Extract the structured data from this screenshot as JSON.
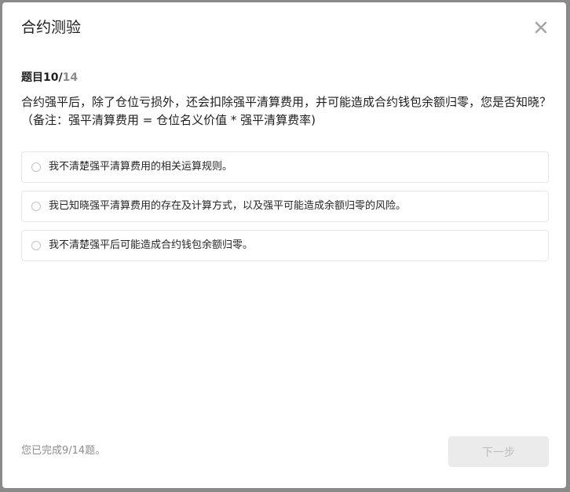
{
  "dialog": {
    "title": "合约测验",
    "close_icon": "close-icon"
  },
  "progress": {
    "label": "题目",
    "current": "10",
    "separator": "/",
    "total": "14"
  },
  "question": {
    "text": "合约强平后，除了仓位亏损外，还会扣除强平清算费用，并可能造成合约钱包余额归零，您是否知晓？（备注：强平清算费用 = 仓位名义价值 * 强平清算费率)"
  },
  "options": [
    {
      "label": "我不清楚强平清算费用的相关运算规则。",
      "selected": false
    },
    {
      "label": "我已知晓强平清算费用的存在及计算方式，以及强平可能造成余额归零的风险。",
      "selected": false
    },
    {
      "label": "我不清楚强平后可能造成合约钱包余额归零。",
      "selected": false
    }
  ],
  "footer": {
    "status": "您已完成9/14题。",
    "next_label": "下一步"
  },
  "colors": {
    "overlay": "#8a8a8a",
    "dialog_bg": "#ffffff",
    "text_primary": "#1f1f1f",
    "text_secondary": "#8c8c8c",
    "option_border": "#e6e6e6",
    "button_disabled_bg": "#ebebeb",
    "button_disabled_text": "#bdbdbd"
  }
}
